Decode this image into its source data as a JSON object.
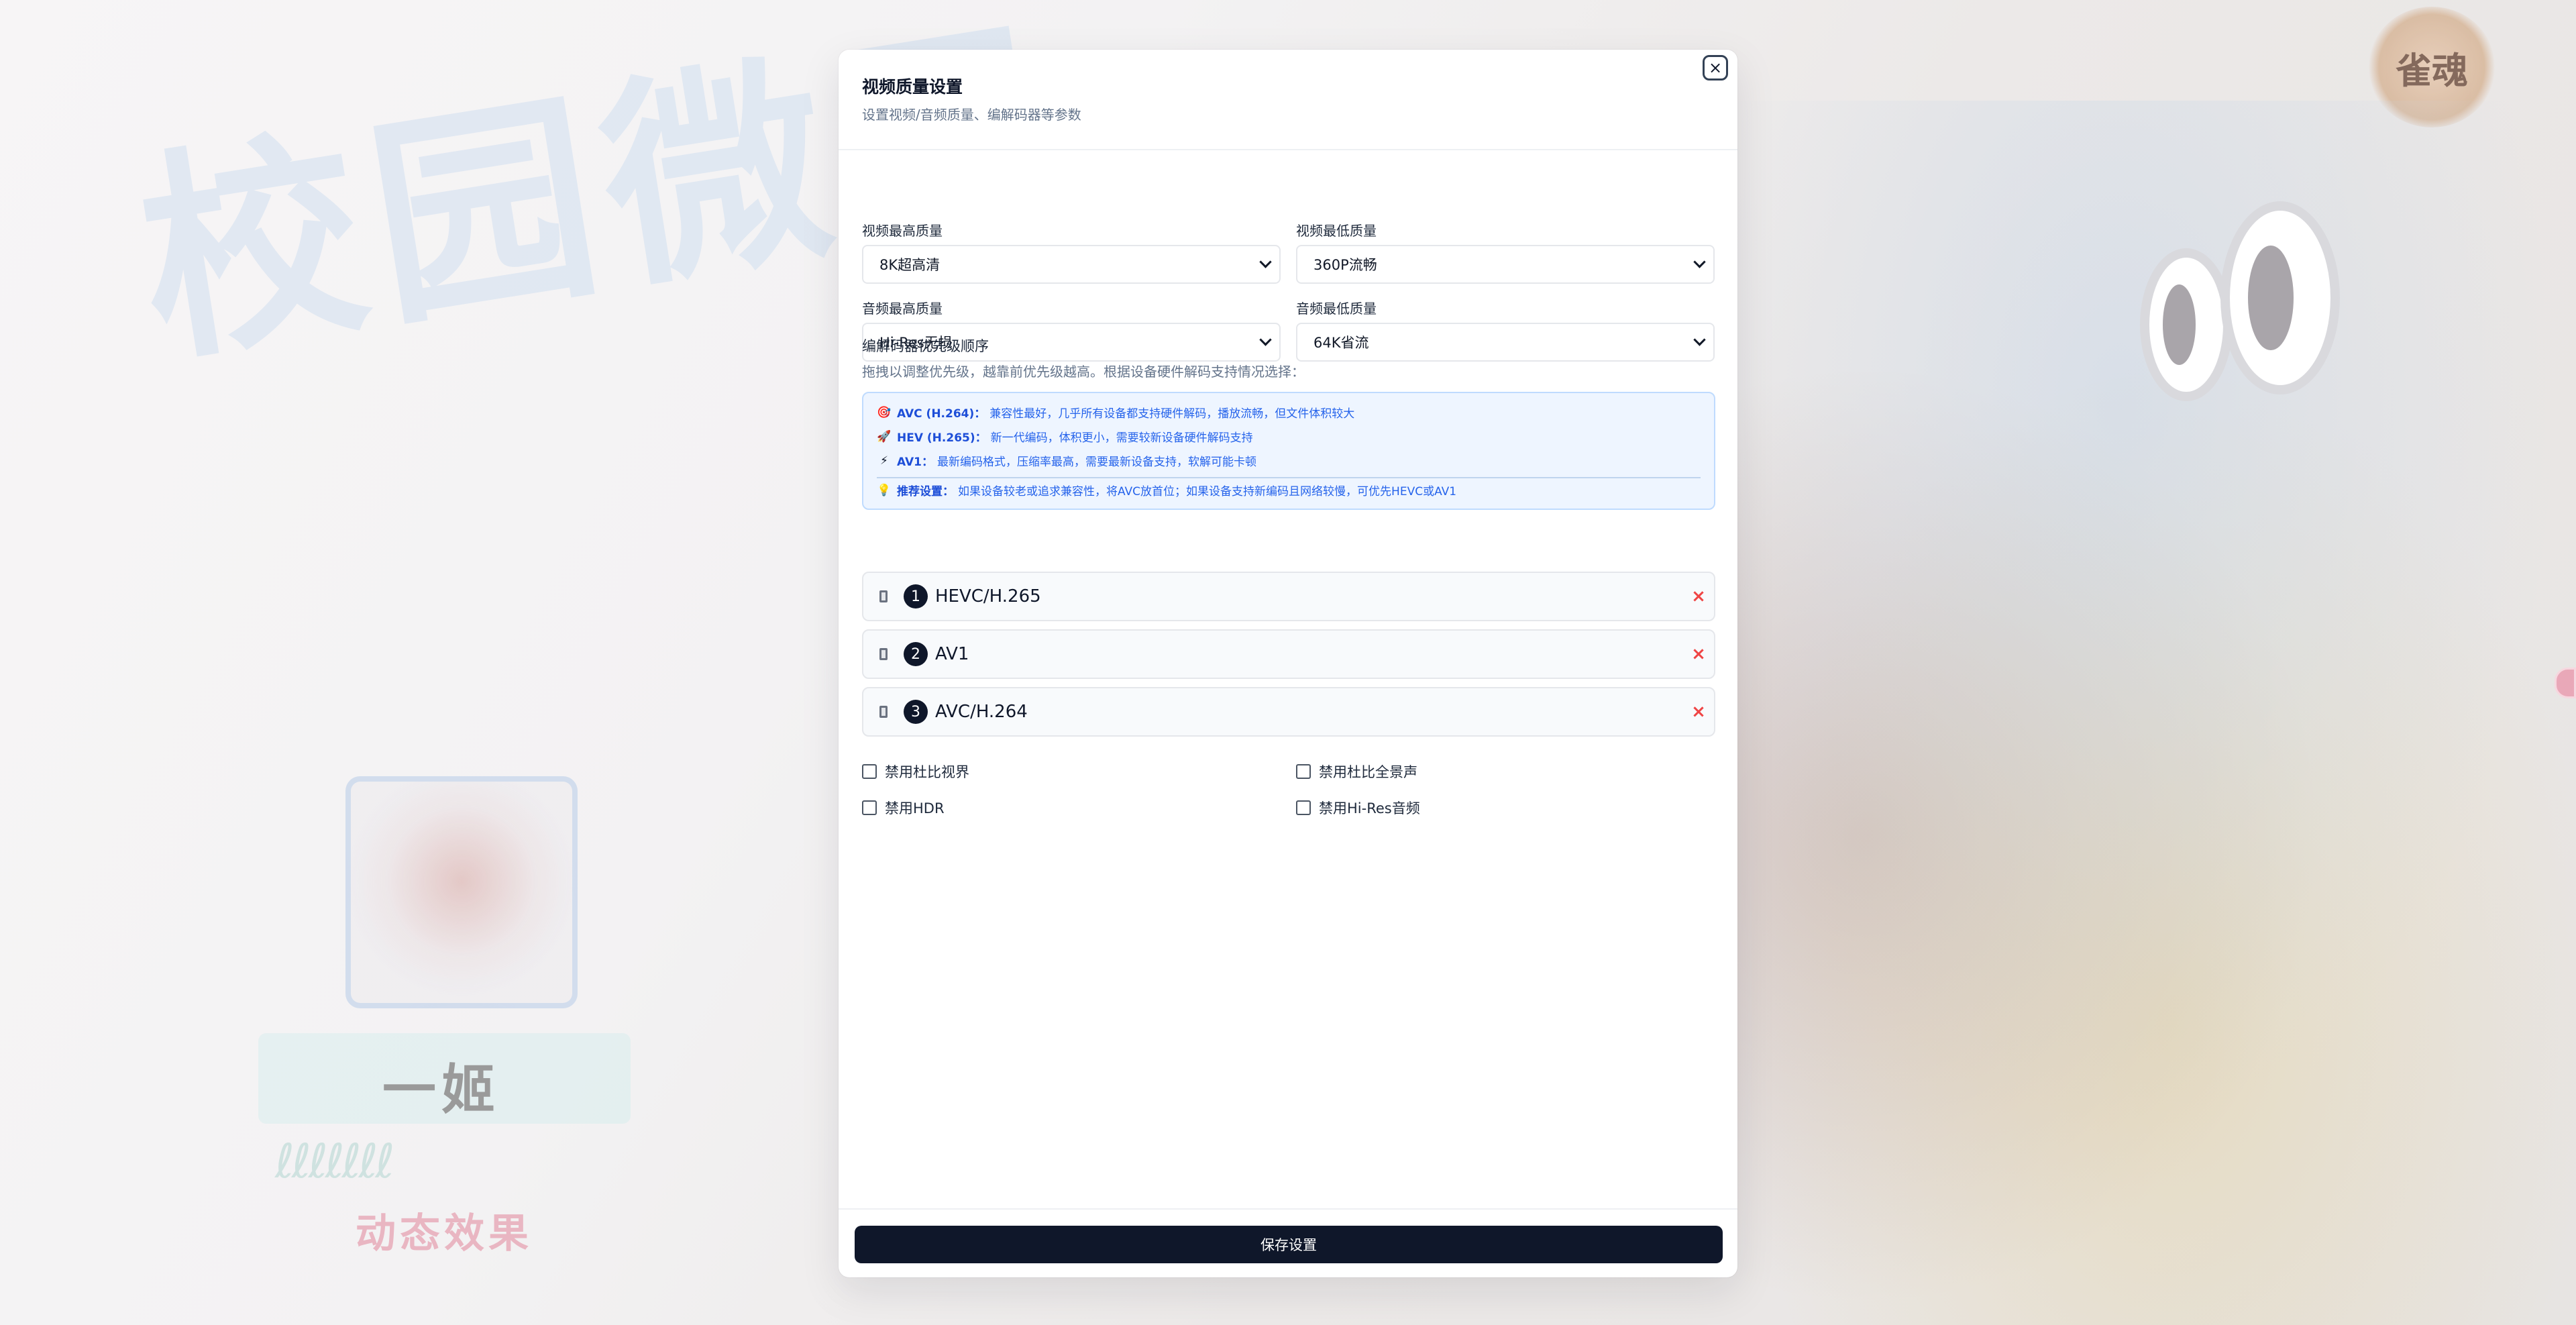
{
  "background": {
    "title_art": "校园微风",
    "logo_art": "雀魂",
    "character_name": "一姬",
    "effect_label": "动态效果",
    "squiggle_art": "ℓℓℓℓℓℓℓ"
  },
  "modal": {
    "title": "视频质量设置",
    "subtitle": "设置视频/音频质量、编解码器等参数",
    "close_icon": "×",
    "fields": {
      "video_max": {
        "label": "视频最高质量",
        "value": "8K超高清"
      },
      "video_min": {
        "label": "视频最低质量",
        "value": "360P流畅"
      },
      "audio_max": {
        "label": "音频最高质量",
        "value": "Hi-Res无损"
      },
      "audio_min": {
        "label": "音频最低质量",
        "value": "64K省流"
      }
    },
    "codec_section": {
      "title": "编解码器优先级顺序",
      "hint": "拖拽以调整优先级，越靠前优先级越高。根据设备硬件解码支持情况选择：",
      "info": [
        {
          "icon": "🎯",
          "key": "AVC (H.264)：",
          "text": "兼容性最好，几乎所有设备都支持硬件解码，播放流畅，但文件体积较大"
        },
        {
          "icon": "🚀",
          "key": "HEV (H.265)：",
          "text": "新一代编码，体积更小，需要较新设备硬件解码支持"
        },
        {
          "icon": "⚡",
          "key": "AV1：",
          "text": "最新编码格式，压缩率最高，需要最新设备支持，软解可能卡顿"
        },
        {
          "icon": "💡",
          "key": "推荐设置：",
          "text": "如果设备较老或追求兼容性，将AVC放首位；如果设备支持新编码且网络较慢，可优先HEVC或AV1"
        }
      ],
      "items": [
        {
          "index": "1",
          "name": "HEVC/H.265",
          "remove": "×"
        },
        {
          "index": "2",
          "name": "AV1",
          "remove": "×"
        },
        {
          "index": "3",
          "name": "AVC/H.264",
          "remove": "×"
        }
      ]
    },
    "toggles": {
      "disable_dolby_vision": "禁用杜比视界",
      "disable_dolby_atmos": "禁用杜比全景声",
      "disable_hdr": "禁用HDR",
      "disable_hires": "禁用Hi-Res音频"
    },
    "save_label": "保存设置"
  }
}
